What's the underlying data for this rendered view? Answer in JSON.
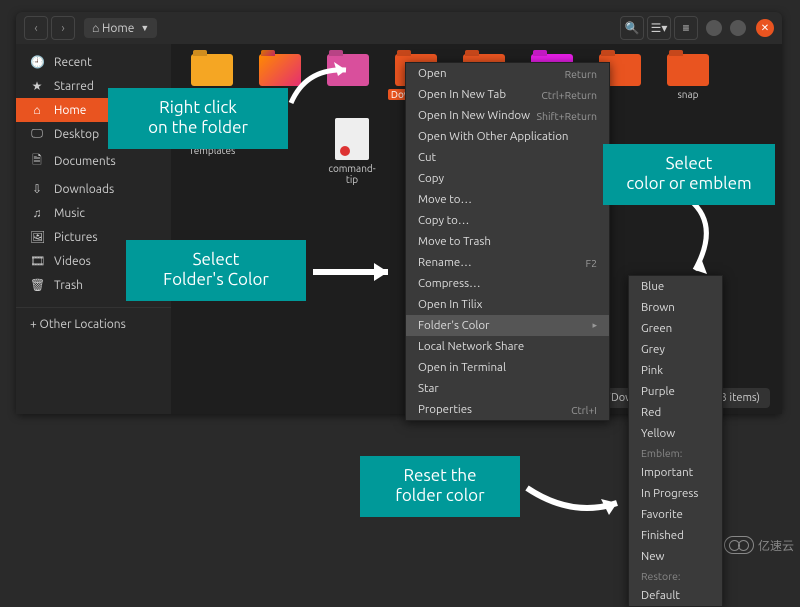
{
  "titlebar": {
    "breadcrumb": "Home"
  },
  "sidebar": {
    "items": [
      {
        "icon": "🕘",
        "label": "Recent"
      },
      {
        "icon": "★",
        "label": "Starred"
      },
      {
        "icon": "⌂",
        "label": "Home",
        "active": true
      },
      {
        "icon": "🖵",
        "label": "Desktop"
      },
      {
        "icon": "🗎",
        "label": "Documents"
      },
      {
        "icon": "⇩",
        "label": "Downloads"
      },
      {
        "icon": "♫",
        "label": "Music"
      },
      {
        "icon": "🖼",
        "label": "Pictures"
      },
      {
        "icon": "🎞",
        "label": "Videos"
      },
      {
        "icon": "🗑",
        "label": "Trash"
      }
    ],
    "other": "+  Other Locations"
  },
  "folders": [
    {
      "label": "",
      "color": "#f5a623"
    },
    {
      "label": "",
      "color": "linear-gradient(135deg,#ff8a00,#e52e71)"
    },
    {
      "label": "",
      "color": "#d94f9c"
    },
    {
      "label": "Downloads",
      "color": "#e95420",
      "selected": true
    },
    {
      "label": "",
      "color": "#e95420"
    },
    {
      "label": "",
      "color": "#e61ee6"
    },
    {
      "label": "",
      "color": "#e95420"
    },
    {
      "label": "snap",
      "color": "#e95420"
    },
    {
      "label": "Templates",
      "color": "#e95420"
    }
  ],
  "docItem": {
    "label": "command-tip"
  },
  "statusbar": "\"Downloads\" selected (3 items)",
  "menu1": [
    {
      "label": "Open",
      "shortcut": "Return"
    },
    {
      "label": "Open In New Tab",
      "shortcut": "Ctrl+Return"
    },
    {
      "label": "Open In New Window",
      "shortcut": "Shift+Return"
    },
    {
      "label": "Open With Other Application"
    },
    {
      "label": "Cut"
    },
    {
      "label": "Copy"
    },
    {
      "label": "Move to…"
    },
    {
      "label": "Copy to…"
    },
    {
      "label": "Move to Trash"
    },
    {
      "label": "Rename…",
      "shortcut": "F2"
    },
    {
      "label": "Compress…"
    },
    {
      "label": "Open In Tilix"
    },
    {
      "label": "Folder's Color",
      "submenu": true,
      "highlight": true
    },
    {
      "label": "Local Network Share"
    },
    {
      "label": "Open in Terminal"
    },
    {
      "label": "Star"
    },
    {
      "label": "Properties",
      "shortcut": "Ctrl+I"
    }
  ],
  "menu2": {
    "colors": [
      "Blue",
      "Brown",
      "Green",
      "Grey",
      "Pink",
      "Purple",
      "Red",
      "Yellow"
    ],
    "emblemHeader": "Emblem:",
    "emblems": [
      "Important",
      "In Progress",
      "Favorite",
      "Finished",
      "New"
    ],
    "restoreHeader": "Restore:",
    "restore": [
      "Default"
    ]
  },
  "callouts": {
    "rightclick": "Right click\non the folder",
    "selectcolor": "Select\nFolder's Color",
    "selectemblem": "Select\ncolor or emblem",
    "reset": "Reset the\nfolder color"
  },
  "watermark": "亿速云"
}
